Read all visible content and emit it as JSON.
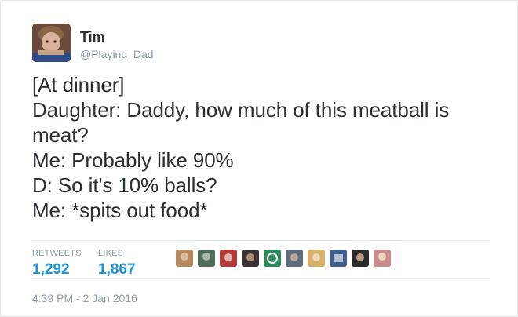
{
  "tweet": {
    "author_name": "Tim",
    "author_handle": "@Playing_Dad",
    "lines": [
      "[At dinner]",
      "Daughter: Daddy, how much of this meatball is",
      "meat?",
      "Me: Probably like 90%",
      "D: So it's 10% balls?",
      "Me: *spits out food*"
    ],
    "timestamp": "4:39 PM - 2 Jan 2016"
  },
  "stats": {
    "retweets_label": "RETWEETS",
    "retweets_value": "1,292",
    "likes_label": "LIKES",
    "likes_value": "1,867"
  },
  "likers": [
    {
      "color": "#b5895e"
    },
    {
      "color": "#4d6b58"
    },
    {
      "color": "#b23a3a"
    },
    {
      "color": "#3a3030"
    },
    {
      "color": "#2d8a5a"
    },
    {
      "color": "#5e6a7a"
    },
    {
      "color": "#d9b06a"
    },
    {
      "color": "#3f5f8f"
    },
    {
      "color": "#2a2a2a"
    },
    {
      "color": "#c98b8b"
    }
  ],
  "colors": {
    "accent": "#1b95e0",
    "text": "#292f33",
    "muted": "#8899a6",
    "border": "#e1e8ed"
  }
}
